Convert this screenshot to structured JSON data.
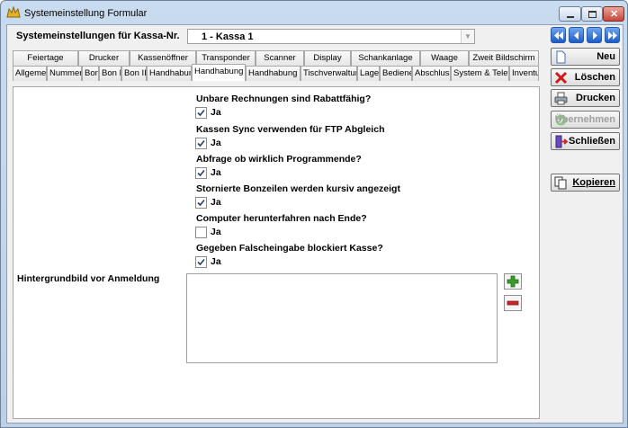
{
  "window": {
    "title": "Systemeinstellung Formular"
  },
  "header": {
    "kassa_label": "Systemeinstellungen für Kassa-Nr.",
    "kassa_value": "1 - Kassa 1"
  },
  "tabs_row1": [
    "Feiertage",
    "Drucker",
    "Kassenöffner",
    "Transponder",
    "Scanner",
    "Display",
    "Schankanlage",
    "Waage",
    "Zweit Bildschirm"
  ],
  "tabs_row2": [
    "Allgemein",
    "Nummern",
    "Bon",
    "Bon II",
    "Bon III",
    "Handhabung",
    "Handhabung II",
    "Handhabung III",
    "Tischverwaltung",
    "Lager",
    "Bediener",
    "Abschluss",
    "System & Telefon",
    "Inventur"
  ],
  "active_tab": "Handhabung II",
  "settings": [
    {
      "question": "Unbare Rechnungen sind Rabattfähig?",
      "checked": true,
      "answer": "Ja"
    },
    {
      "question": "Kassen Sync verwenden für FTP Abgleich",
      "checked": true,
      "answer": "Ja"
    },
    {
      "question": "Abfrage ob wirklich Programmende?",
      "checked": true,
      "answer": "Ja"
    },
    {
      "question": "Stornierte Bonzeilen werden kursiv angezeigt",
      "checked": true,
      "answer": "Ja"
    },
    {
      "question": "Computer herunterfahren nach Ende?",
      "checked": false,
      "answer": "Ja"
    },
    {
      "question": "Gegeben Falscheingabe blockiert Kasse?",
      "checked": true,
      "answer": "Ja"
    }
  ],
  "background": {
    "label": "Hintergrundbild vor Anmeldung",
    "value": ""
  },
  "sidebar": {
    "neu": "Neu",
    "loeschen": "Löschen",
    "drucken": "Drucken",
    "uebernehmen": "Übernehmen",
    "schliessen": "Schließen",
    "kopieren": "Kopieren"
  },
  "colors": {
    "accent": "#1d5cc9",
    "add": "#3a9a2a",
    "remove": "#c8262b"
  }
}
